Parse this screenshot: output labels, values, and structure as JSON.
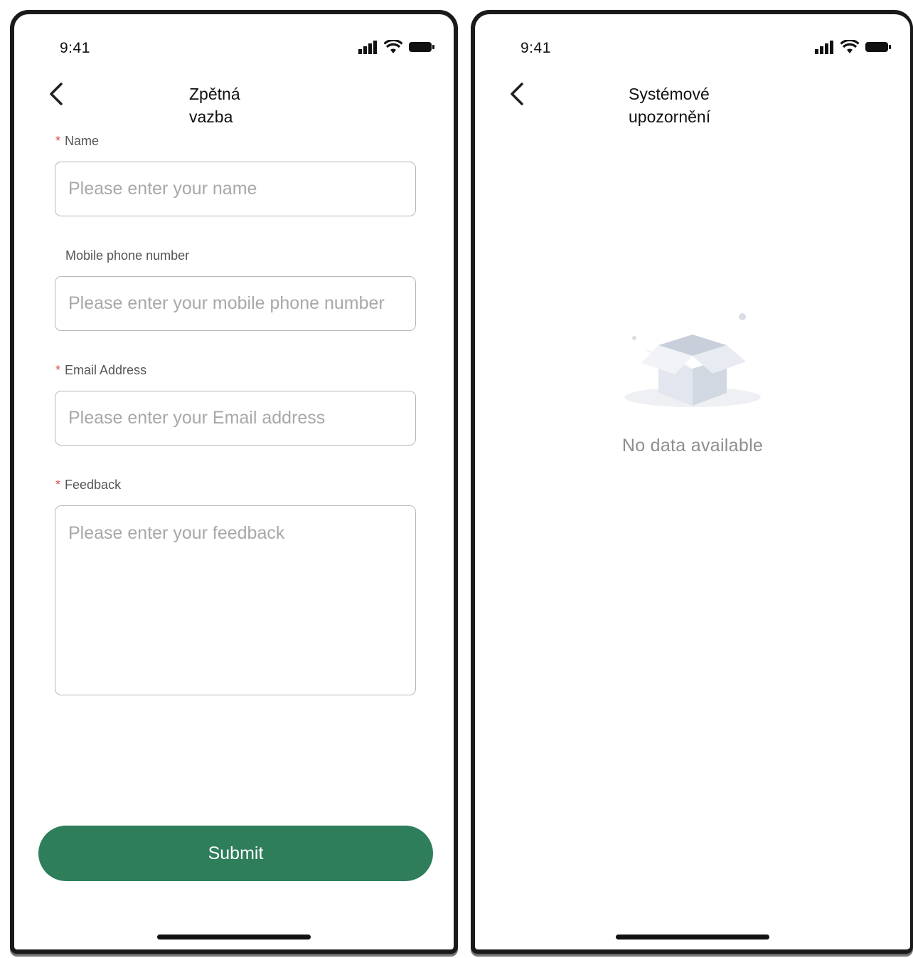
{
  "status_bar": {
    "time": "9:41"
  },
  "feedback_screen": {
    "title": "Zpětná vazba",
    "fields": {
      "name": {
        "label": "Name",
        "required_mark": "*",
        "placeholder": "Please enter your name"
      },
      "phone": {
        "label": "Mobile phone number",
        "placeholder": "Please enter your mobile phone number"
      },
      "email": {
        "label": "Email Address",
        "required_mark": "*",
        "placeholder": "Please enter your Email address"
      },
      "feedback": {
        "label": "Feedback",
        "required_mark": "*",
        "placeholder": "Please enter your feedback"
      }
    },
    "submit_label": "Submit"
  },
  "notifications_screen": {
    "title": "Systémové upozornění",
    "empty_text": "No data available"
  },
  "colors": {
    "primary_button": "#2e7d5b",
    "required_asterisk": "#d9534f",
    "placeholder": "#a8a8a8"
  },
  "icons": [
    "back-chevron-icon",
    "signal-icon",
    "wifi-icon",
    "battery-icon",
    "empty-box-icon"
  ]
}
